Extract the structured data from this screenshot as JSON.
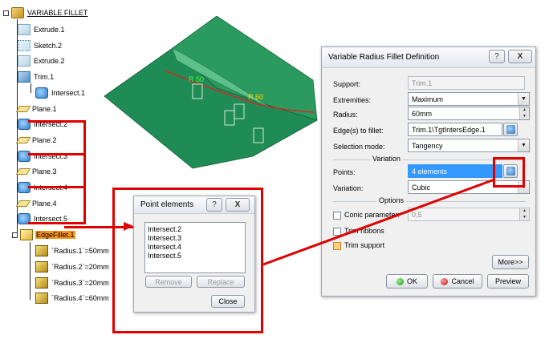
{
  "tree": {
    "root": "VARIABLE FILLET",
    "nodes": [
      {
        "label": "Extrude.1",
        "icon": "extrude-icon"
      },
      {
        "label": "Sketch.2",
        "icon": "sketch-icon"
      },
      {
        "label": "Extrude.2",
        "icon": "extrude-icon"
      },
      {
        "label": "Trim.1",
        "icon": "trim-icon"
      },
      {
        "label": "Intersect.1",
        "icon": "intersect-icon"
      },
      {
        "label": "Plane.1",
        "icon": "plane-icon"
      },
      {
        "label": "Intersect.2",
        "icon": "intersect-icon"
      },
      {
        "label": "Plane.2",
        "icon": "plane-icon"
      },
      {
        "label": "Intersect.3",
        "icon": "intersect-icon"
      },
      {
        "label": "Plane.3",
        "icon": "plane-icon"
      },
      {
        "label": "Intersect.4",
        "icon": "intersect-icon"
      },
      {
        "label": "Plane.4",
        "icon": "plane-icon"
      },
      {
        "label": "Intersect.5",
        "icon": "intersect-icon"
      },
      {
        "label": "EdgeFillet.1",
        "icon": "edge-fillet-icon"
      },
      {
        "label": "`Radius.1`=50mm",
        "icon": "radius-parameter-icon"
      },
      {
        "label": "`Radius.2`=20mm",
        "icon": "radius-parameter-icon"
      },
      {
        "label": "`Radius.3`=20mm",
        "icon": "radius-parameter-icon"
      },
      {
        "label": "`Radius.4`=60mm",
        "icon": "radius-parameter-icon"
      }
    ]
  },
  "viewport": {
    "labels": [
      "R 50",
      "R 60"
    ]
  },
  "fillet_dialog": {
    "title": "Variable Radius Fillet Definition",
    "help_button": "?",
    "close_button": "X",
    "support_label": "Support:",
    "support_value": "Trim.1",
    "extremities_label": "Extremities:",
    "extremities_value": "Maximum",
    "radius_label": "Radius:",
    "radius_value": "60mm",
    "edges_label": "Edge(s) to fillet:",
    "edges_value": "Trim.1\\TgtIntersEdge.1",
    "selection_mode_label": "Selection mode:",
    "selection_mode_value": "Tangency",
    "variation_section": "Variation",
    "points_label": "Points:",
    "points_value": "4 elements",
    "variation_label": "Variation:",
    "variation_value": "Cubic",
    "options_section": "Options",
    "conic_label": "Conic parameter:",
    "conic_value": "0,5",
    "trim_ribbons_label": "Trim ribbons",
    "trim_support_label": "Trim support",
    "more_button": "More>>",
    "ok_button": "OK",
    "cancel_button": "Cancel",
    "preview_button": "Preview"
  },
  "points_dialog": {
    "title": "Point elements",
    "help_button": "?",
    "close_button": "X",
    "items": [
      "Intersect.2",
      "Intersect.3",
      "Intersect.4",
      "Intersect.5"
    ],
    "remove_button": "Remove",
    "replace_button": "Replace",
    "close_label": "Close"
  },
  "colors": {
    "highlight": "#e00000",
    "selected_node": "#f7941d",
    "surface": "#2e8b57"
  }
}
